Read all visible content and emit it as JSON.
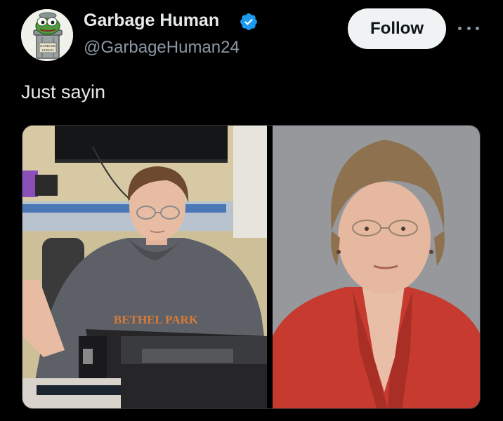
{
  "author": {
    "display_name": "Garbage Human",
    "handle": "@GarbageHuman24",
    "avatar_icon": "pepe-in-trash-can-icon",
    "avatar_sign_text": "GARBAGE HUMAN",
    "verified_icon": "verified-badge-icon",
    "verified_color": "#1d9bf0"
  },
  "actions": {
    "follow_label": "Follow",
    "more_icon": "more-options-icon"
  },
  "tweet": {
    "text": "Just sayin"
  },
  "media": {
    "left_photo": {
      "description": "young man in grey hoodie at a desk with computer hardware",
      "hoodie_text": "BETHEL PARK"
    },
    "right_photo": {
      "description": "older woman with short hair and glasses in a red blazer"
    }
  },
  "colors": {
    "background": "#000000",
    "primary_text": "#e7e9ea",
    "secondary_text": "#8b98a5",
    "follow_bg": "#eff3f4"
  }
}
